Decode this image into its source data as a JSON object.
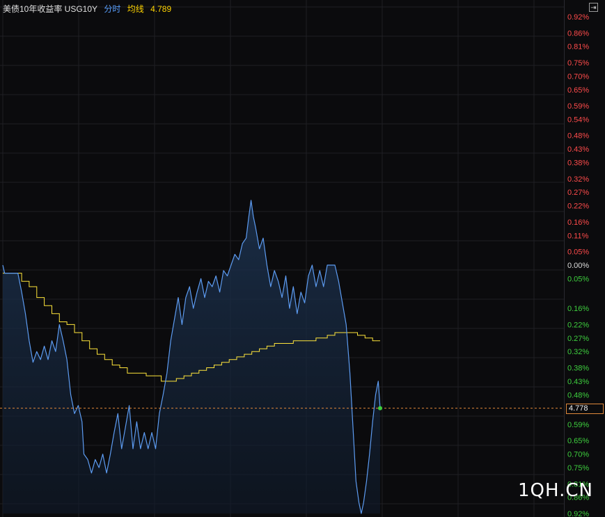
{
  "header": {
    "title": "美债10年收益率 USG10Y",
    "mode": "分时",
    "avg_label": "均线",
    "avg_value": "4.789"
  },
  "toggle_icon": "panel-toggle-icon",
  "current_price_label": "4.778",
  "watermark": "1QH.CN",
  "colors": {
    "up": "#ff4b4b",
    "down": "#3ecf3e",
    "price_line": "#5d9cf2",
    "avg_line": "#ffe53b",
    "current_line": "#e0893b",
    "grid": "#1f1f24",
    "background": "#0b0b0d"
  },
  "chart_data": {
    "type": "line",
    "base": 0.0,
    "axis_labels": [
      {
        "v": 0.92,
        "t": "0.92%"
      },
      {
        "v": 0.86,
        "t": "0.86%"
      },
      {
        "v": 0.81,
        "t": "0.81%"
      },
      {
        "v": 0.75,
        "t": "0.75%"
      },
      {
        "v": 0.7,
        "t": "0.70%"
      },
      {
        "v": 0.65,
        "t": "0.65%"
      },
      {
        "v": 0.59,
        "t": "0.59%"
      },
      {
        "v": 0.54,
        "t": "0.54%"
      },
      {
        "v": 0.48,
        "t": "0.48%"
      },
      {
        "v": 0.43,
        "t": "0.43%"
      },
      {
        "v": 0.38,
        "t": "0.38%"
      },
      {
        "v": 0.32,
        "t": "0.32%"
      },
      {
        "v": 0.27,
        "t": "0.27%"
      },
      {
        "v": 0.22,
        "t": "0.22%"
      },
      {
        "v": 0.16,
        "t": "0.16%"
      },
      {
        "v": 0.11,
        "t": "0.11%"
      },
      {
        "v": 0.05,
        "t": "0.05%"
      },
      {
        "v": 0.0,
        "t": "0.00%"
      },
      {
        "v": -0.05,
        "t": "0.05%"
      },
      {
        "v": -0.16,
        "t": "0.16%"
      },
      {
        "v": -0.22,
        "t": "0.22%"
      },
      {
        "v": -0.27,
        "t": "0.27%"
      },
      {
        "v": -0.32,
        "t": "0.32%"
      },
      {
        "v": -0.38,
        "t": "0.38%"
      },
      {
        "v": -0.43,
        "t": "0.43%"
      },
      {
        "v": -0.48,
        "t": "0.48%"
      },
      {
        "v": -0.59,
        "t": "0.59%"
      },
      {
        "v": -0.65,
        "t": "0.65%"
      },
      {
        "v": -0.7,
        "t": "0.70%"
      },
      {
        "v": -0.75,
        "t": "0.75%"
      },
      {
        "v": -0.81,
        "t": "0.81%"
      },
      {
        "v": -0.86,
        "t": "0.86%"
      },
      {
        "v": -0.92,
        "t": "0.92%"
      }
    ],
    "ylim": [
      -0.92,
      0.92
    ],
    "xlim": [
      0,
      1
    ],
    "current_value": -0.53,
    "price_series": [
      [
        0.0,
        0.0
      ],
      [
        0.005,
        -0.03
      ],
      [
        0.02,
        -0.03
      ],
      [
        0.04,
        -0.03
      ],
      [
        0.05,
        -0.1
      ],
      [
        0.06,
        -0.18
      ],
      [
        0.07,
        -0.28
      ],
      [
        0.08,
        -0.36
      ],
      [
        0.09,
        -0.32
      ],
      [
        0.1,
        -0.35
      ],
      [
        0.11,
        -0.3
      ],
      [
        0.12,
        -0.35
      ],
      [
        0.13,
        -0.28
      ],
      [
        0.14,
        -0.32
      ],
      [
        0.15,
        -0.22
      ],
      [
        0.16,
        -0.28
      ],
      [
        0.17,
        -0.35
      ],
      [
        0.18,
        -0.48
      ],
      [
        0.19,
        -0.55
      ],
      [
        0.2,
        -0.52
      ],
      [
        0.21,
        -0.58
      ],
      [
        0.215,
        -0.7
      ],
      [
        0.225,
        -0.72
      ],
      [
        0.235,
        -0.77
      ],
      [
        0.245,
        -0.72
      ],
      [
        0.255,
        -0.75
      ],
      [
        0.265,
        -0.7
      ],
      [
        0.275,
        -0.77
      ],
      [
        0.285,
        -0.7
      ],
      [
        0.295,
        -0.62
      ],
      [
        0.305,
        -0.55
      ],
      [
        0.315,
        -0.68
      ],
      [
        0.325,
        -0.6
      ],
      [
        0.335,
        -0.52
      ],
      [
        0.345,
        -0.68
      ],
      [
        0.355,
        -0.58
      ],
      [
        0.365,
        -0.68
      ],
      [
        0.375,
        -0.62
      ],
      [
        0.385,
        -0.68
      ],
      [
        0.395,
        -0.62
      ],
      [
        0.405,
        -0.68
      ],
      [
        0.415,
        -0.55
      ],
      [
        0.425,
        -0.48
      ],
      [
        0.435,
        -0.4
      ],
      [
        0.445,
        -0.28
      ],
      [
        0.455,
        -0.2
      ],
      [
        0.465,
        -0.12
      ],
      [
        0.475,
        -0.22
      ],
      [
        0.485,
        -0.12
      ],
      [
        0.495,
        -0.08
      ],
      [
        0.505,
        -0.16
      ],
      [
        0.515,
        -0.1
      ],
      [
        0.525,
        -0.05
      ],
      [
        0.535,
        -0.12
      ],
      [
        0.545,
        -0.06
      ],
      [
        0.555,
        -0.08
      ],
      [
        0.565,
        -0.04
      ],
      [
        0.575,
        -0.1
      ],
      [
        0.585,
        -0.02
      ],
      [
        0.595,
        -0.04
      ],
      [
        0.605,
        0.0
      ],
      [
        0.615,
        0.04
      ],
      [
        0.625,
        0.02
      ],
      [
        0.635,
        0.08
      ],
      [
        0.645,
        0.1
      ],
      [
        0.652,
        0.18
      ],
      [
        0.658,
        0.24
      ],
      [
        0.664,
        0.18
      ],
      [
        0.67,
        0.14
      ],
      [
        0.68,
        0.06
      ],
      [
        0.69,
        0.1
      ],
      [
        0.7,
        0.0
      ],
      [
        0.71,
        -0.08
      ],
      [
        0.72,
        -0.02
      ],
      [
        0.73,
        -0.06
      ],
      [
        0.74,
        -0.12
      ],
      [
        0.75,
        -0.04
      ],
      [
        0.76,
        -0.16
      ],
      [
        0.77,
        -0.08
      ],
      [
        0.78,
        -0.18
      ],
      [
        0.79,
        -0.1
      ],
      [
        0.8,
        -0.14
      ],
      [
        0.81,
        -0.04
      ],
      [
        0.82,
        0.0
      ],
      [
        0.83,
        -0.08
      ],
      [
        0.84,
        -0.02
      ],
      [
        0.85,
        -0.08
      ],
      [
        0.86,
        0.0
      ],
      [
        0.87,
        0.0
      ],
      [
        0.88,
        0.0
      ],
      [
        0.89,
        -0.06
      ],
      [
        0.9,
        -0.14
      ],
      [
        0.91,
        -0.22
      ],
      [
        0.92,
        -0.4
      ],
      [
        0.928,
        -0.6
      ],
      [
        0.936,
        -0.8
      ],
      [
        0.944,
        -0.88
      ],
      [
        0.95,
        -0.92
      ],
      [
        0.956,
        -0.88
      ],
      [
        0.964,
        -0.8
      ],
      [
        0.972,
        -0.7
      ],
      [
        0.98,
        -0.58
      ],
      [
        0.988,
        -0.48
      ],
      [
        0.995,
        -0.43
      ],
      [
        1.0,
        -0.53
      ]
    ],
    "avg_series": [
      [
        0.0,
        -0.03
      ],
      [
        0.04,
        -0.03
      ],
      [
        0.05,
        -0.06
      ],
      [
        0.07,
        -0.08
      ],
      [
        0.09,
        -0.12
      ],
      [
        0.11,
        -0.15
      ],
      [
        0.13,
        -0.18
      ],
      [
        0.15,
        -0.21
      ],
      [
        0.17,
        -0.22
      ],
      [
        0.19,
        -0.25
      ],
      [
        0.21,
        -0.28
      ],
      [
        0.23,
        -0.31
      ],
      [
        0.25,
        -0.33
      ],
      [
        0.27,
        -0.35
      ],
      [
        0.29,
        -0.37
      ],
      [
        0.31,
        -0.38
      ],
      [
        0.33,
        -0.4
      ],
      [
        0.35,
        -0.4
      ],
      [
        0.38,
        -0.41
      ],
      [
        0.42,
        -0.43
      ],
      [
        0.44,
        -0.43
      ],
      [
        0.46,
        -0.42
      ],
      [
        0.48,
        -0.41
      ],
      [
        0.5,
        -0.4
      ],
      [
        0.52,
        -0.39
      ],
      [
        0.54,
        -0.38
      ],
      [
        0.56,
        -0.37
      ],
      [
        0.58,
        -0.36
      ],
      [
        0.6,
        -0.35
      ],
      [
        0.62,
        -0.34
      ],
      [
        0.64,
        -0.33
      ],
      [
        0.66,
        -0.32
      ],
      [
        0.68,
        -0.31
      ],
      [
        0.7,
        -0.3
      ],
      [
        0.72,
        -0.29
      ],
      [
        0.74,
        -0.29
      ],
      [
        0.77,
        -0.28
      ],
      [
        0.8,
        -0.28
      ],
      [
        0.83,
        -0.27
      ],
      [
        0.86,
        -0.26
      ],
      [
        0.88,
        -0.25
      ],
      [
        0.9,
        -0.25
      ],
      [
        0.92,
        -0.25
      ],
      [
        0.94,
        -0.26
      ],
      [
        0.96,
        -0.27
      ],
      [
        0.98,
        -0.28
      ],
      [
        1.0,
        -0.28
      ]
    ]
  }
}
